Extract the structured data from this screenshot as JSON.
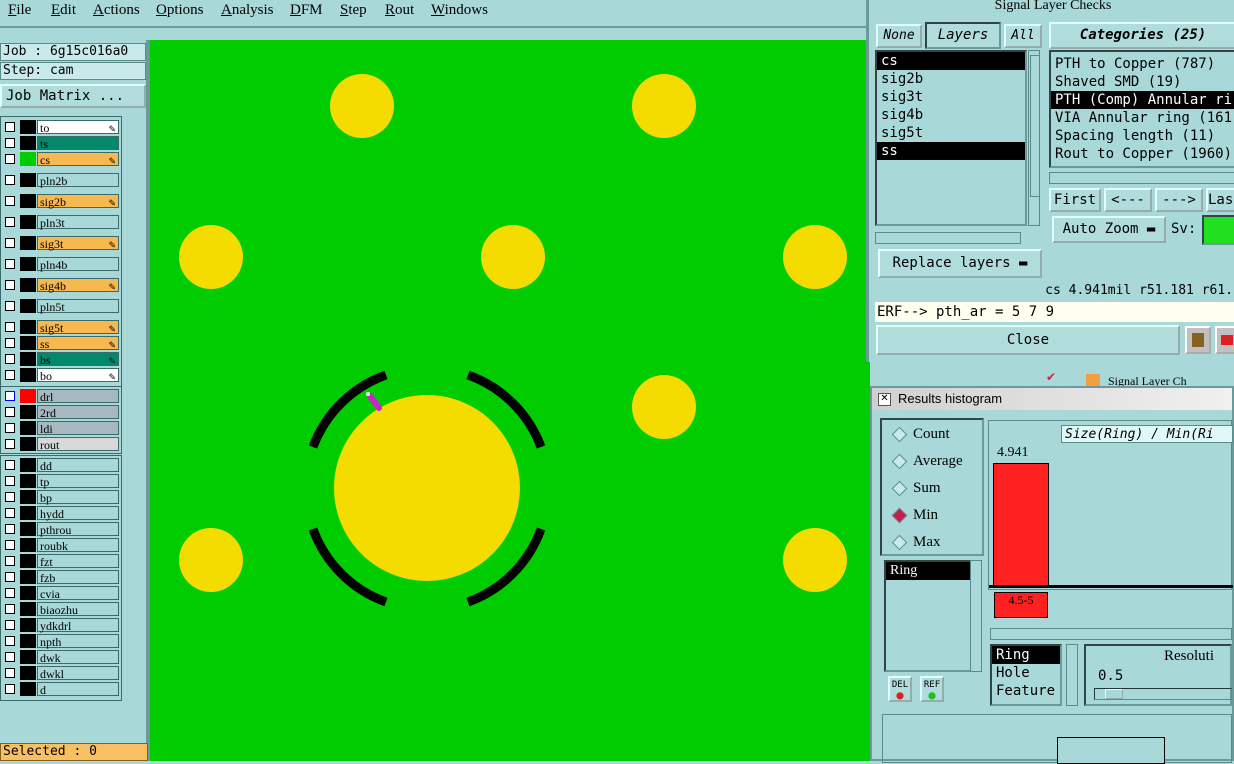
{
  "menu": [
    "File",
    "Edit",
    "Actions",
    "Options",
    "Analysis",
    "DFM",
    "Step",
    "Rout",
    "Windows"
  ],
  "job": "Job : 6g15c016a0",
  "step": "Step: cam",
  "job_matrix": "Job Matrix ...",
  "layers_group1": [
    {
      "name": "to",
      "color": "#ffffff",
      "sw": "#000000",
      "pen": true
    },
    {
      "name": "ts",
      "color": "#008a6a",
      "sw": "#000000",
      "pen": false
    },
    {
      "name": "cs",
      "color": "#f8b850",
      "sw": "#00cc00",
      "pen": true
    },
    {
      "name": "pln2b",
      "color": "#a8d8d8",
      "sw": "#000000",
      "pen": false
    },
    {
      "name": "sig2b",
      "color": "#f8b850",
      "sw": "#000000",
      "pen": true
    },
    {
      "name": "pln3t",
      "color": "#a8d8d8",
      "sw": "#000000",
      "pen": false
    },
    {
      "name": "sig3t",
      "color": "#f8b850",
      "sw": "#000000",
      "pen": true
    },
    {
      "name": "pln4b",
      "color": "#a8d8d8",
      "sw": "#000000",
      "pen": false
    },
    {
      "name": "sig4b",
      "color": "#f8b850",
      "sw": "#000000",
      "pen": true
    },
    {
      "name": "pln5t",
      "color": "#a8d8d8",
      "sw": "#000000",
      "pen": false
    },
    {
      "name": "sig5t",
      "color": "#f8b850",
      "sw": "#000000",
      "pen": true
    },
    {
      "name": "ss",
      "color": "#f8b850",
      "sw": "#000000",
      "pen": true
    },
    {
      "name": "bs",
      "color": "#008a6a",
      "sw": "#000000",
      "pen": true
    },
    {
      "name": "bo",
      "color": "#ffffff",
      "sw": "#000000",
      "pen": true
    }
  ],
  "layers_group2": [
    {
      "name": "drl",
      "color": "#a8b8c0",
      "sw": "#ff0000",
      "pen": false
    },
    {
      "name": "2rd",
      "color": "#a8b8c0",
      "sw": "#000000",
      "pen": false
    },
    {
      "name": "ldi",
      "color": "#a8b8c0",
      "sw": "#000000",
      "pen": false
    },
    {
      "name": "rout",
      "color": "#d8d8d8",
      "sw": "#000000",
      "pen": false
    }
  ],
  "layers_group3": [
    "dd",
    "tp",
    "bp",
    "hydd",
    "pthrou",
    "roubk",
    "fzt",
    "fzb",
    "cvia",
    "biaozhu",
    "ydkdrl",
    "npth",
    "dwk",
    "dwkl",
    "d"
  ],
  "selected": "Selected : 0",
  "slc": {
    "title": "Signal Layer Checks",
    "none_btn": "None",
    "layers_btn": "Layers",
    "all_btn": "All",
    "categories_btn": "Categories (25)",
    "layer_list": [
      "cs",
      "sig2b",
      "sig3t",
      "sig4b",
      "sig5t",
      "ss"
    ],
    "selected_layers": [
      "cs",
      "ss"
    ],
    "categories": [
      "PTH to Copper (787)",
      "Shaved SMD (19)",
      "PTH (Comp) Annular ri",
      "VIA Annular ring (161",
      "Spacing length (11)",
      "Rout to Copper (1960)"
    ],
    "selected_category": "PTH (Comp) Annular ri",
    "first_btn": "First",
    "prev_btn": "<---",
    "next_btn": "--->",
    "last_btn": "Last",
    "auto_zoom": "Auto Zoom",
    "sv_label": "Sv:",
    "replace_layers": "Replace layers",
    "status": "cs 4.941mil  r51.181  r61.",
    "erf": "ERF--> pth_ar = 5 7 9",
    "close_btn": "Close",
    "behind_title": "Signal Layer Ch"
  },
  "hist": {
    "title": "Results histogram",
    "modes": [
      "Count",
      "Average",
      "Sum",
      "Min",
      "Max"
    ],
    "selected_mode": "Min",
    "ring_field": "Ring",
    "chart_title": "Size(Ring) / Min(Ri",
    "bar_value": "4.941",
    "bar_label": "4.5-5",
    "types": [
      "Ring",
      "Hole",
      "Feature"
    ],
    "selected_type": "Ring",
    "resolution_label": "Resoluti",
    "resolution_value": "0.5",
    "del_btn": "DEL",
    "ref_btn": "REF"
  },
  "colors": {
    "board": "#00cc00",
    "pad": "#f5dc00",
    "ring": "#000000",
    "bar": "#ff2020"
  }
}
